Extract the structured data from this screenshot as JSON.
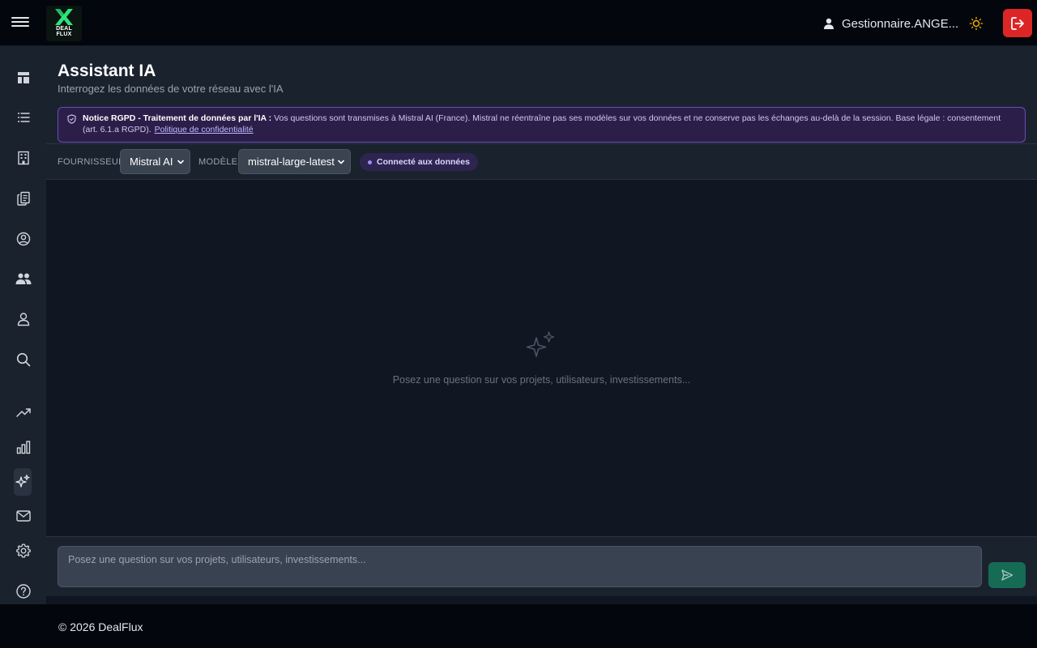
{
  "app": {
    "logo_text": "DEAL\nFLUX",
    "brand_color": "#2ee37a"
  },
  "topbar": {
    "user_name": "Gestionnaire.ANGE...",
    "icons": [
      "menu-icon",
      "user-icon",
      "sun-icon",
      "logout-icon"
    ]
  },
  "sidebar": {
    "items": [
      {
        "icon": "dashboard-icon"
      },
      {
        "icon": "list-icon"
      },
      {
        "icon": "building-icon"
      },
      {
        "icon": "documents-icon"
      },
      {
        "icon": "user-circle-icon"
      },
      {
        "icon": "users-icon"
      },
      {
        "icon": "user-icon"
      },
      {
        "icon": "search-icon"
      },
      {
        "icon": "trending-up-icon"
      },
      {
        "icon": "bar-chart-icon"
      },
      {
        "icon": "sparkles-icon",
        "active": true
      },
      {
        "icon": "mail-icon"
      },
      {
        "icon": "gear-icon"
      },
      {
        "icon": "help-icon"
      }
    ]
  },
  "page": {
    "title": "Assistant IA",
    "subtitle": "Interrogez les données de votre réseau avec l'IA"
  },
  "notice": {
    "title": "Notice RGPD - Traitement de données par l'IA :",
    "text": " Vos questions sont transmises à Mistral AI (France). Mistral ne réentraîne pas ses modèles sur vos données et ne conserve pas les échanges au-delà de la session. Base légale : consentement (art. 6.1.a RGPD).",
    "link": "Politique de confidentialité"
  },
  "toolbar": {
    "provider_label": "FOURNISSEUR",
    "provider_value": "Mistral AI",
    "model_label": "MODÈLE",
    "model_value": "mistral-large-latest",
    "status_badge": "Connecté aux données"
  },
  "chat": {
    "empty_text": "Posez une question sur vos projets, utilisateurs, investissements..."
  },
  "composer": {
    "placeholder": "Posez une question sur vos projets, utilisateurs, investissements..."
  },
  "footer": {
    "copyright": "©  2026 DealFlux"
  }
}
